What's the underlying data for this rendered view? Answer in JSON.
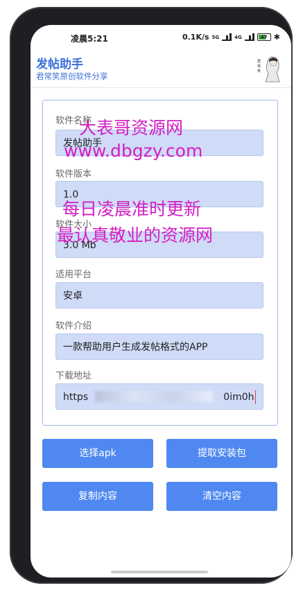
{
  "status_bar": {
    "time": "凌晨5:21",
    "speed": "0.1K/s",
    "net1": "5G",
    "net2": "4G",
    "battery": "47"
  },
  "header": {
    "title": "发帖助手",
    "subtitle": "君常笑原创软件分享"
  },
  "form": {
    "name_label": "软件名称",
    "name_value": "发帖助手",
    "version_label": "软件版本",
    "version_value": "1.0",
    "size_label": "软件大小",
    "size_value": "3.0 Mb",
    "platform_label": "适用平台",
    "platform_value": "安卓",
    "intro_label": "软件介绍",
    "intro_value": "一款帮助用户生成发帖格式的APP",
    "url_label": "下载地址",
    "url_prefix": "https",
    "url_suffix": "0im0h"
  },
  "buttons": {
    "select_apk": "选择apk",
    "extract": "提取安装包",
    "copy": "复制内容",
    "clear": "清空内容"
  },
  "watermark": {
    "line1": "大表哥资源网",
    "line2": "www.dbgzy.com",
    "line3": "每日凌晨准时更新",
    "line4": "最认真敬业的资源网"
  },
  "colors": {
    "accent": "#4f88f0",
    "title": "#3a6fd8",
    "field_bg": "#cfdbf7",
    "watermark": "#d41ec4"
  }
}
